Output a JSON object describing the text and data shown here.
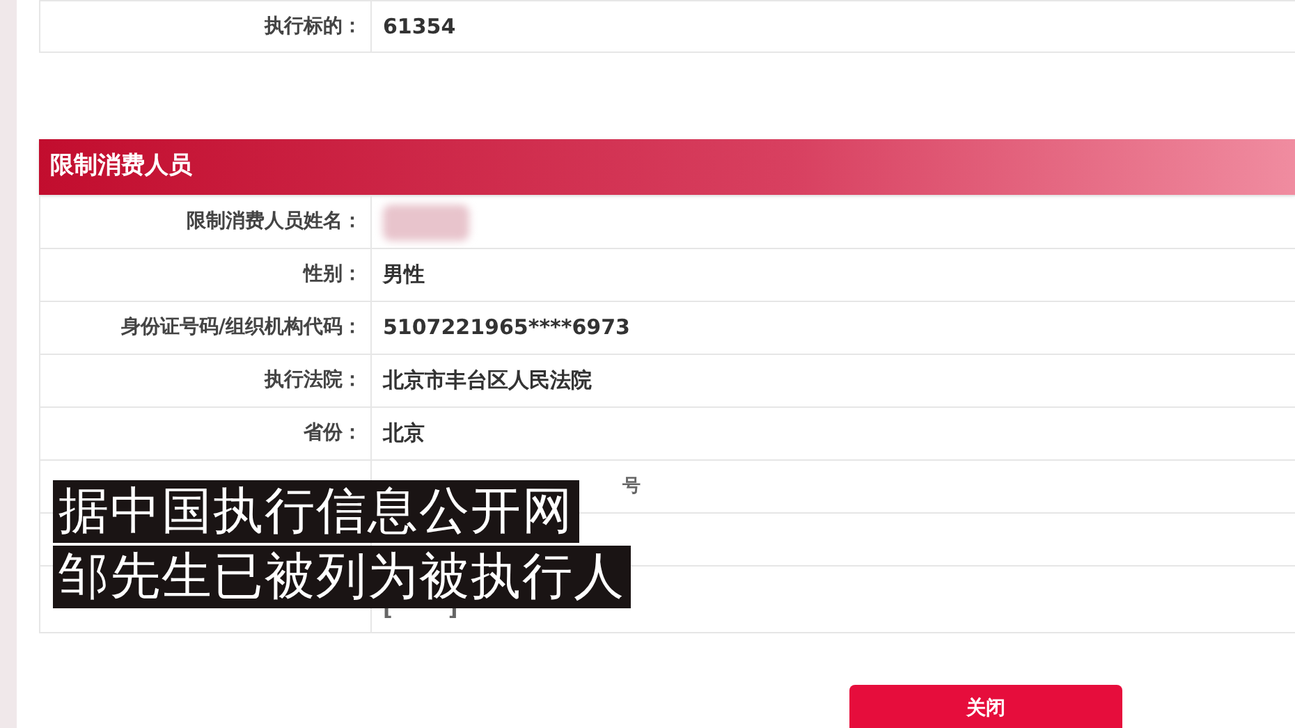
{
  "top_rows": [
    {
      "label": "执行标的：",
      "value": "61354"
    }
  ],
  "section": {
    "title": "限制消费人员"
  },
  "rows": [
    {
      "kind": "blurred",
      "label": "限制消费人员姓名："
    },
    {
      "kind": "text",
      "label": "性别：",
      "value": "男性"
    },
    {
      "kind": "text",
      "label": "身份证号码/组织机构代码：",
      "value": "5107221965****6973"
    },
    {
      "kind": "text",
      "label": "执行法院：",
      "value": "北京市丰台区人民法院"
    },
    {
      "kind": "text",
      "label": "省份：",
      "value": "北京"
    },
    {
      "kind": "tail",
      "value": "号"
    },
    {
      "kind": "hidden"
    },
    {
      "kind": "link",
      "open": "[",
      "close": "]"
    }
  ],
  "close_button": {
    "label": "关闭"
  },
  "captions": [
    "据中国执行信息公开网",
    "邹先生已被列为被执行人"
  ]
}
